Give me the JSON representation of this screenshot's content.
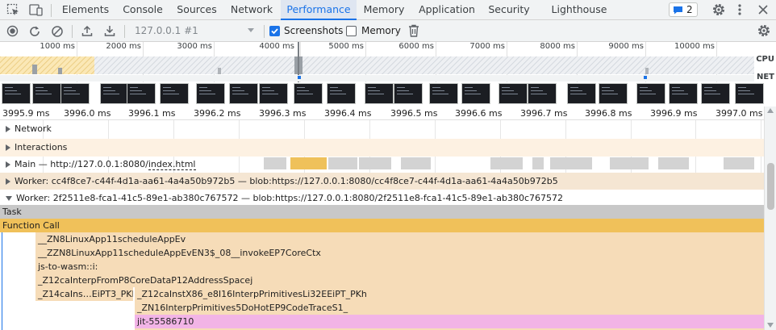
{
  "tabs": [
    {
      "label": "Elements",
      "active": false
    },
    {
      "label": "Console",
      "active": false
    },
    {
      "label": "Sources",
      "active": false
    },
    {
      "label": "Network",
      "active": false
    },
    {
      "label": "Performance",
      "active": true
    },
    {
      "label": "Memory",
      "active": false
    },
    {
      "label": "Application",
      "active": false
    },
    {
      "label": "Security",
      "active": false
    },
    {
      "label": "Lighthouse",
      "active": false
    }
  ],
  "issues_badge": "2",
  "toolbar": {
    "profile_select": "127.0.0.1 #1",
    "screenshots_label": "Screenshots",
    "screenshots_checked": true,
    "memory_label": "Memory",
    "memory_checked": false
  },
  "overview": {
    "ticks": [
      "1000 ms",
      "2000 ms",
      "3000 ms",
      "4000 ms",
      "5000 ms",
      "6000 ms",
      "7000 ms",
      "8000 ms",
      "9000 ms",
      "10000 ms"
    ],
    "cpu_label": "CPU",
    "net_label": "NET"
  },
  "ruler": {
    "ticks": [
      "3995.9 ms",
      "3996.0 ms",
      "3996.1 ms",
      "3996.2 ms",
      "3996.3 ms",
      "3996.4 ms",
      "3996.5 ms",
      "3996.6 ms",
      "3996.7 ms",
      "3996.8 ms",
      "3996.9 ms",
      "3997.0 ms"
    ]
  },
  "tracks": {
    "network": "Network",
    "interactions": "Interactions",
    "main_prefix": "Main — http://127.0.0.1:8080/",
    "main_link": "index.html",
    "worker1": "Worker: cc4f8ce7-c44f-4d1a-aa61-4a4a50b972b5 — blob:https://127.0.0.1:8080/cc4f8ce7-c44f-4d1a-aa61-4a4a50b972b5",
    "worker2": "Worker: 2f2511e8-fca1-41c5-89e1-ab380c767572 — blob:https://127.0.0.1:8080/2f2511e8-fca1-41c5-89e1-ab380c767572"
  },
  "flame": {
    "task": "Task",
    "function_call": "Function Call",
    "rows": [
      "__ZN8LinuxApp11scheduleAppEv",
      "__ZZN8LinuxApp11scheduleAppEvEN3$_08__invokeEP7CoreCtx",
      "js-to-wasm::i:",
      "_Z12caInterpFromP8CoreDataP12AddressSpacej"
    ],
    "row5_left": "_Z14caIns…EiPT3_PKh",
    "row5_right": "_Z12caInstX86_e8I16InterpPrimitivesLi32EEiPT_PKh",
    "row6": "_ZN16InterpPrimitives5DoHotEP9CodeTraceS1_",
    "row7": "jit-55586710"
  },
  "colors": {
    "accent": "#1a73e8",
    "task": "#c8c8c8",
    "function_call": "#f0c15a",
    "frame": "#f6dcb8",
    "jit": "#f2b4e6",
    "interactions_bg": "#fdf1e2",
    "worker_bg": "#f5e6d3"
  }
}
